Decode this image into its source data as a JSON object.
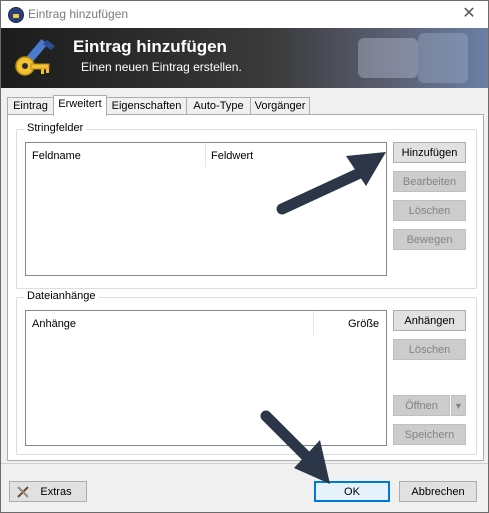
{
  "window": {
    "title": "Eintrag hinzufügen",
    "close_glyph": "✕"
  },
  "banner": {
    "title": "Eintrag hinzufügen",
    "subtitle": "Einen neuen Eintrag erstellen."
  },
  "tabs": [
    {
      "label": "Eintrag",
      "active": false
    },
    {
      "label": "Erweitert",
      "active": true
    },
    {
      "label": "Eigenschaften",
      "active": false
    },
    {
      "label": "Auto-Type",
      "active": false
    },
    {
      "label": "Vorgänger",
      "active": false
    }
  ],
  "stringfields": {
    "legend": "Stringfelder",
    "col_name": "Feldname",
    "col_value": "Feldwert",
    "buttons": {
      "add": "Hinzufügen",
      "edit": "Bearbeiten",
      "delete": "Löschen",
      "move": "Bewegen"
    }
  },
  "attachments": {
    "legend": "Dateianhänge",
    "col_name": "Anhänge",
    "col_size": "Größe",
    "buttons": {
      "attach": "Anhängen",
      "delete": "Löschen",
      "open": "Öffnen",
      "save": "Speichern"
    }
  },
  "footer": {
    "extras": "Extras",
    "ok": "OK",
    "cancel": "Abbrechen"
  },
  "colors": {
    "annotation_arrow": "#2b3648",
    "accent": "#0078d7"
  },
  "icons": {
    "app": "lock-icon",
    "banner": "key-pencil-icon",
    "extras": "tools-icon",
    "dropdown": "chevron-down-icon"
  }
}
